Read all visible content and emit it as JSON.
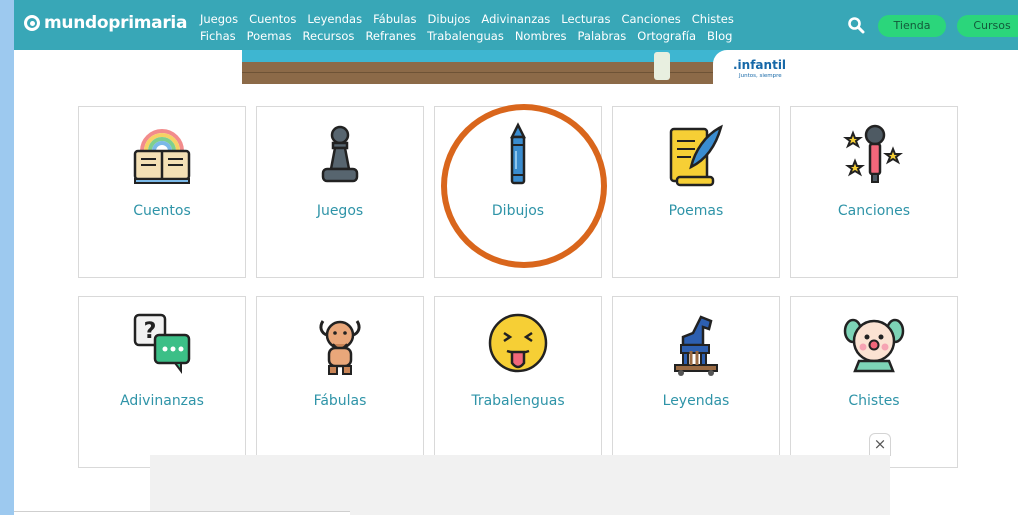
{
  "brand": {
    "name": "mundoprimaria"
  },
  "nav": {
    "row1": [
      "Juegos",
      "Cuentos",
      "Leyendas",
      "Fábulas",
      "Dibujos",
      "Adivinanzas",
      "Lecturas",
      "Canciones",
      "Chistes"
    ],
    "row2": [
      "Fichas",
      "Poemas",
      "Recursos",
      "Refranes",
      "Trabalenguas",
      "Nombres",
      "Palabras",
      "Ortografía",
      "Blog"
    ]
  },
  "actions": {
    "search_icon": "search-icon",
    "tienda": "Tienda",
    "cursos": "Cursos"
  },
  "banner": {
    "badge_title": ".infantil",
    "badge_sub": "Juntos, siempre"
  },
  "categories": [
    {
      "label": "Cuentos",
      "icon": "rainbow-book-icon"
    },
    {
      "label": "Juegos",
      "icon": "chess-pawn-icon"
    },
    {
      "label": "Dibujos",
      "icon": "crayon-icon"
    },
    {
      "label": "Poemas",
      "icon": "scroll-quill-icon"
    },
    {
      "label": "Canciones",
      "icon": "microphone-stars-icon"
    },
    {
      "label": "Adivinanzas",
      "icon": "question-chat-icon"
    },
    {
      "label": "Fábulas",
      "icon": "faun-icon"
    },
    {
      "label": "Trabalenguas",
      "icon": "tongue-face-icon"
    },
    {
      "label": "Leyendas",
      "icon": "trojan-horse-icon"
    },
    {
      "label": "Chistes",
      "icon": "clown-icon"
    }
  ],
  "ad": {
    "close_label": "×"
  },
  "colors": {
    "header": "#38a7b7",
    "accent_green": "#2bd67b",
    "link": "#2f94a8",
    "highlight": "#d9661c"
  }
}
